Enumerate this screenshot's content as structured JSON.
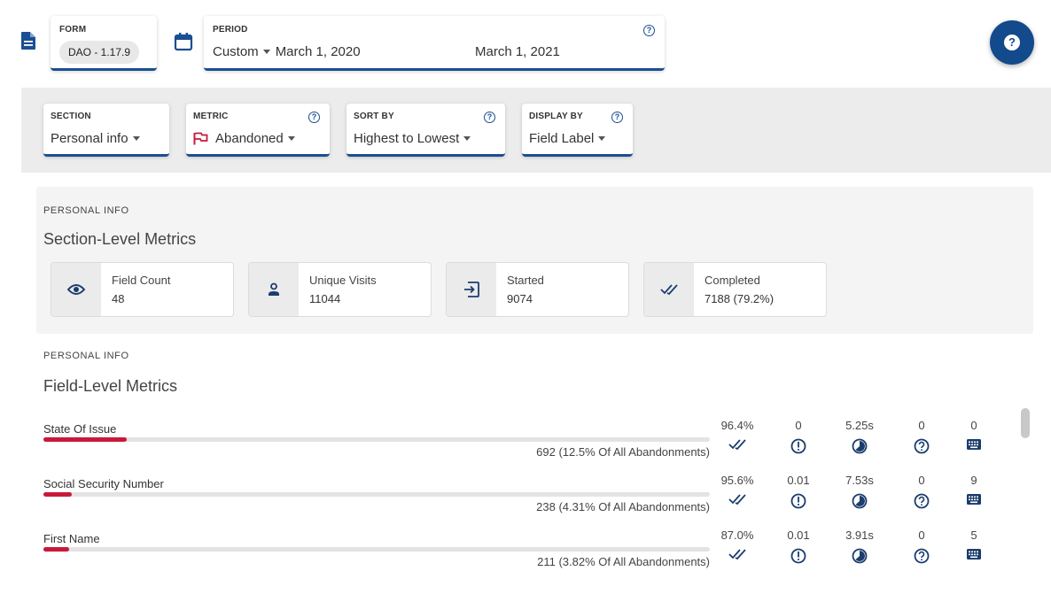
{
  "header": {
    "form": {
      "label": "FORM",
      "value": "DAO - 1.17.9"
    },
    "period": {
      "label": "PERIOD",
      "mode": "Custom",
      "start": "March 1, 2020",
      "end": "March 1, 2021"
    }
  },
  "filters": [
    {
      "label": "SECTION",
      "value": "Personal info"
    },
    {
      "label": "METRIC",
      "value": "Abandoned",
      "icon": "flag-icon"
    },
    {
      "label": "SORT BY",
      "value": "Highest to Lowest"
    },
    {
      "label": "DISPLAY BY",
      "value": "Field Label"
    }
  ],
  "section_metrics": {
    "kicker": "PERSONAL INFO",
    "title": "Section-Level Metrics",
    "cards": [
      {
        "label": "Field Count",
        "value": "48",
        "icon": "eye-icon"
      },
      {
        "label": "Unique Visits",
        "value": "11044",
        "icon": "person-icon"
      },
      {
        "label": "Started",
        "value": "9074",
        "icon": "login-icon"
      },
      {
        "label": "Completed",
        "value": "7188 (79.2%)",
        "icon": "double-check-icon"
      }
    ]
  },
  "field_metrics": {
    "kicker": "PERSONAL INFO",
    "title": "Field-Level Metrics",
    "rows": [
      {
        "name": "State Of Issue",
        "abandon": "692 (12.5% Of All Abandonments)",
        "share": 0.125,
        "completion": "96.4%",
        "errors": "0",
        "time": "5.25s",
        "help": "0",
        "keystrokes": "0"
      },
      {
        "name": "Social Security Number",
        "abandon": "238 (4.31% Of All Abandonments)",
        "share": 0.0431,
        "completion": "95.6%",
        "errors": "0.01",
        "time": "7.53s",
        "help": "0",
        "keystrokes": "9"
      },
      {
        "name": "First Name",
        "abandon": "211 (3.82% Of All Abandonments)",
        "share": 0.0382,
        "completion": "87.0%",
        "errors": "0.01",
        "time": "3.91s",
        "help": "0",
        "keystrokes": "5"
      }
    ]
  },
  "colors": {
    "primary": "#1a4f91",
    "accent_red": "#c8193a",
    "panel_bg": "#ececec"
  }
}
